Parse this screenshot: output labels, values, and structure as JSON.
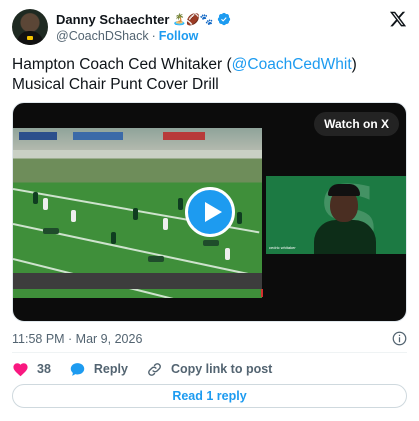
{
  "author": {
    "display_name": "Danny Schaechter",
    "emojis": "🏝️🏈🐾",
    "handle": "@CoachDShack",
    "separator": "·",
    "follow_label": "Follow"
  },
  "tweet": {
    "text_before": "Hampton Coach Ced Whitaker (",
    "mention": "@CoachCedWhit",
    "text_after": ") Musical Chair Punt Cover Drill"
  },
  "media": {
    "watch_label": "Watch on X",
    "inset_label": "cedric whitaker"
  },
  "meta": {
    "timestamp": "11:58 PM · Mar 9, 2026"
  },
  "actions": {
    "like_count": "38",
    "reply_label": "Reply",
    "copy_label": "Copy link to post"
  },
  "read_reply_label": "Read 1 reply",
  "colors": {
    "accent": "#1d9bf0",
    "like": "#f91880",
    "secondary_text": "#536471"
  }
}
